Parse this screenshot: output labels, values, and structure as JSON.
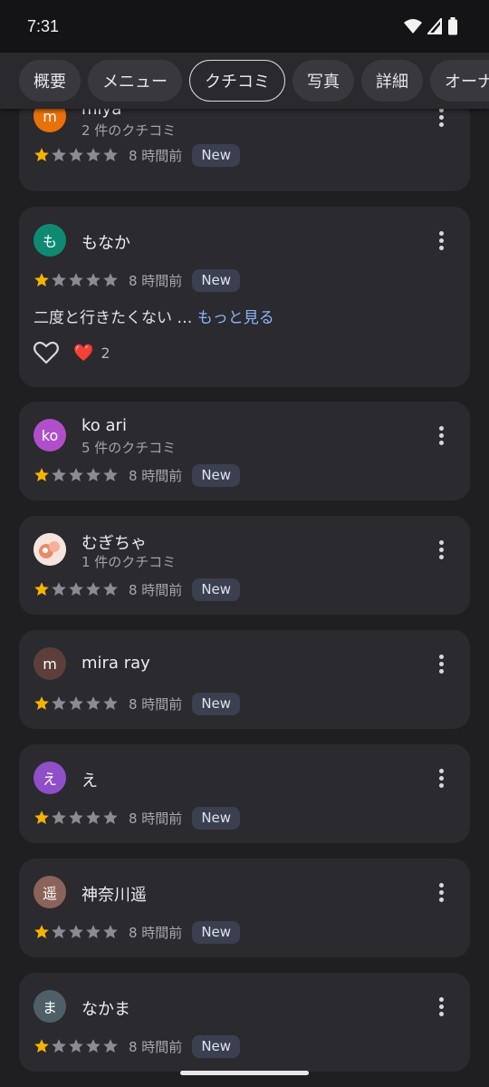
{
  "status": {
    "time": "7:31"
  },
  "tabs": [
    {
      "label": "概要"
    },
    {
      "label": "メニュー"
    },
    {
      "label": "クチコミ"
    },
    {
      "label": "写真"
    },
    {
      "label": "詳細"
    },
    {
      "label": "オーナー"
    }
  ],
  "active_tab": "クチコミ",
  "reviews": [
    {
      "name": "miya",
      "subtitle": "2 件のクチコミ",
      "initial": "m",
      "avatar_color": "#e8710a",
      "rating": 1,
      "time": "8 時間前",
      "badge": "New"
    },
    {
      "name": "もなか",
      "subtitle": "",
      "initial": "も",
      "avatar_color": "#0f8a72",
      "rating": 1,
      "time": "8 時間前",
      "badge": "New",
      "text": "二度と行きたくない …",
      "more_link": "もっと見る",
      "reaction_emoji": "❤️",
      "reaction_count": "2"
    },
    {
      "name": "ko ari",
      "subtitle": "5 件のクチコミ",
      "initial": "ko",
      "avatar_color": "#b04fc9",
      "rating": 1,
      "time": "8 時間前",
      "badge": "New"
    },
    {
      "name": "むぎちゃ",
      "subtitle": "1 件のクチコミ",
      "initial": "",
      "avatar_color": "#f3dcd6",
      "rating": 1,
      "time": "8 時間前",
      "badge": "New"
    },
    {
      "name": "mira ray",
      "subtitle": "",
      "initial": "m",
      "avatar_color": "#5b3f38",
      "rating": 1,
      "time": "8 時間前",
      "badge": "New"
    },
    {
      "name": "え",
      "subtitle": "",
      "initial": "え",
      "avatar_color": "#8f4fc8",
      "rating": 1,
      "time": "8 時間前",
      "badge": "New"
    },
    {
      "name": "神奈川遥",
      "subtitle": "",
      "initial": "遥",
      "avatar_color": "#8b6359",
      "rating": 1,
      "time": "8 時間前",
      "badge": "New"
    },
    {
      "name": "なかま",
      "subtitle": "",
      "initial": "ま",
      "avatar_color": "#4f5f68",
      "rating": 1,
      "time": "8 時間前",
      "badge": "New"
    }
  ],
  "colors": {
    "star_filled": "#f5b400",
    "star_empty": "#8c8b91",
    "link": "#8ab4f8"
  }
}
